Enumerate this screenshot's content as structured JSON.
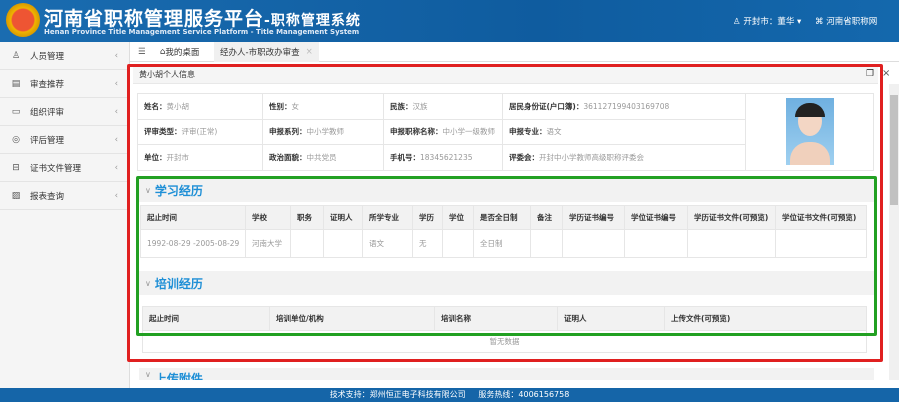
{
  "header": {
    "title_cn": "河南省职称管理服务平台",
    "title_cn_sub": "-职称管理系统",
    "title_en": "Henan Province Title Management Service Platform - Title Management System",
    "user": "开封市：董华",
    "site_link": "河南省职称网"
  },
  "sidebar": {
    "items": [
      {
        "label": "人员管理",
        "icon": "user-icon"
      },
      {
        "label": "审查推荐",
        "icon": "document-icon"
      },
      {
        "label": "组织评审",
        "icon": "card-icon"
      },
      {
        "label": "评后管理",
        "icon": "circle-icon"
      },
      {
        "label": "证书文件管理",
        "icon": "book-icon"
      },
      {
        "label": "报表查询",
        "icon": "image-icon"
      }
    ]
  },
  "tabs": {
    "home": "我的桌面",
    "active": "经办人-市职改办审查"
  },
  "panel": {
    "title": "黄小胡个人信息"
  },
  "info": {
    "name_label": "姓名：",
    "name": "黄小胡",
    "gender_label": "性别：",
    "gender": "女",
    "ethnic_label": "民族：",
    "ethnic": "汉族",
    "id_label": "居民身份证(户口簿)：",
    "id": "361127199403169708",
    "review_type_label": "评审类型：",
    "review_type": "评审(正常)",
    "series_label": "申报系列：",
    "series": "中小学教师",
    "title_label": "申报职称名称：",
    "title": "中小学一级教师",
    "major_label": "申报专业：",
    "major": "语文",
    "unit_label": "单位：",
    "unit": "开封市",
    "politics_label": "政治面貌：",
    "politics": "中共党员",
    "phone_label": "手机号：",
    "phone": "18345621235",
    "committee_label": "评委会：",
    "committee": "开封中小学教师高级职称评委会"
  },
  "education": {
    "title": "学习经历",
    "headers": [
      "起止时间",
      "学校",
      "职务",
      "证明人",
      "所学专业",
      "学历",
      "学位",
      "是否全日制",
      "备注",
      "学历证书编号",
      "学位证书编号",
      "学历证书文件(可预览)",
      "学位证书文件(可预览)"
    ],
    "rows": [
      [
        "1992-08-29 -2005-08-29",
        "河南大学",
        "",
        "",
        "语文",
        "无",
        "",
        "全日制",
        "",
        "",
        "",
        "",
        ""
      ]
    ]
  },
  "training": {
    "title": "培训经历",
    "headers": [
      "起止时间",
      "培训单位/机构",
      "培训名称",
      "证明人",
      "上传文件(可预览)"
    ],
    "empty": "暂无数据"
  },
  "attachments": {
    "title": "上传附件"
  },
  "footer": {
    "support": "技术支持：郑州恒正电子科技有限公司",
    "hotline": "服务热线：4006156758"
  }
}
